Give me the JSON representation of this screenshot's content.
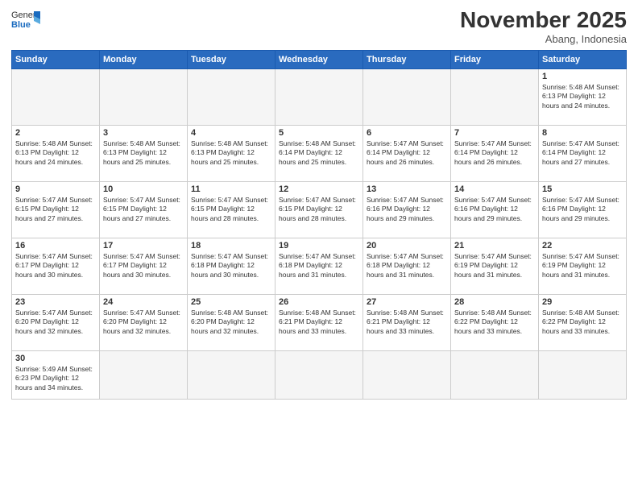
{
  "logo": {
    "line1": "General",
    "line2": "Blue"
  },
  "title": "November 2025",
  "location": "Abang, Indonesia",
  "weekdays": [
    "Sunday",
    "Monday",
    "Tuesday",
    "Wednesday",
    "Thursday",
    "Friday",
    "Saturday"
  ],
  "weeks": [
    [
      {
        "day": "",
        "info": ""
      },
      {
        "day": "",
        "info": ""
      },
      {
        "day": "",
        "info": ""
      },
      {
        "day": "",
        "info": ""
      },
      {
        "day": "",
        "info": ""
      },
      {
        "day": "",
        "info": ""
      },
      {
        "day": "1",
        "info": "Sunrise: 5:48 AM\nSunset: 6:13 PM\nDaylight: 12 hours\nand 24 minutes."
      }
    ],
    [
      {
        "day": "2",
        "info": "Sunrise: 5:48 AM\nSunset: 6:13 PM\nDaylight: 12 hours\nand 24 minutes."
      },
      {
        "day": "3",
        "info": "Sunrise: 5:48 AM\nSunset: 6:13 PM\nDaylight: 12 hours\nand 25 minutes."
      },
      {
        "day": "4",
        "info": "Sunrise: 5:48 AM\nSunset: 6:13 PM\nDaylight: 12 hours\nand 25 minutes."
      },
      {
        "day": "5",
        "info": "Sunrise: 5:48 AM\nSunset: 6:14 PM\nDaylight: 12 hours\nand 25 minutes."
      },
      {
        "day": "6",
        "info": "Sunrise: 5:47 AM\nSunset: 6:14 PM\nDaylight: 12 hours\nand 26 minutes."
      },
      {
        "day": "7",
        "info": "Sunrise: 5:47 AM\nSunset: 6:14 PM\nDaylight: 12 hours\nand 26 minutes."
      },
      {
        "day": "8",
        "info": "Sunrise: 5:47 AM\nSunset: 6:14 PM\nDaylight: 12 hours\nand 27 minutes."
      }
    ],
    [
      {
        "day": "9",
        "info": "Sunrise: 5:47 AM\nSunset: 6:15 PM\nDaylight: 12 hours\nand 27 minutes."
      },
      {
        "day": "10",
        "info": "Sunrise: 5:47 AM\nSunset: 6:15 PM\nDaylight: 12 hours\nand 27 minutes."
      },
      {
        "day": "11",
        "info": "Sunrise: 5:47 AM\nSunset: 6:15 PM\nDaylight: 12 hours\nand 28 minutes."
      },
      {
        "day": "12",
        "info": "Sunrise: 5:47 AM\nSunset: 6:15 PM\nDaylight: 12 hours\nand 28 minutes."
      },
      {
        "day": "13",
        "info": "Sunrise: 5:47 AM\nSunset: 6:16 PM\nDaylight: 12 hours\nand 29 minutes."
      },
      {
        "day": "14",
        "info": "Sunrise: 5:47 AM\nSunset: 6:16 PM\nDaylight: 12 hours\nand 29 minutes."
      },
      {
        "day": "15",
        "info": "Sunrise: 5:47 AM\nSunset: 6:16 PM\nDaylight: 12 hours\nand 29 minutes."
      }
    ],
    [
      {
        "day": "16",
        "info": "Sunrise: 5:47 AM\nSunset: 6:17 PM\nDaylight: 12 hours\nand 30 minutes."
      },
      {
        "day": "17",
        "info": "Sunrise: 5:47 AM\nSunset: 6:17 PM\nDaylight: 12 hours\nand 30 minutes."
      },
      {
        "day": "18",
        "info": "Sunrise: 5:47 AM\nSunset: 6:18 PM\nDaylight: 12 hours\nand 30 minutes."
      },
      {
        "day": "19",
        "info": "Sunrise: 5:47 AM\nSunset: 6:18 PM\nDaylight: 12 hours\nand 31 minutes."
      },
      {
        "day": "20",
        "info": "Sunrise: 5:47 AM\nSunset: 6:18 PM\nDaylight: 12 hours\nand 31 minutes."
      },
      {
        "day": "21",
        "info": "Sunrise: 5:47 AM\nSunset: 6:19 PM\nDaylight: 12 hours\nand 31 minutes."
      },
      {
        "day": "22",
        "info": "Sunrise: 5:47 AM\nSunset: 6:19 PM\nDaylight: 12 hours\nand 31 minutes."
      }
    ],
    [
      {
        "day": "23",
        "info": "Sunrise: 5:47 AM\nSunset: 6:20 PM\nDaylight: 12 hours\nand 32 minutes."
      },
      {
        "day": "24",
        "info": "Sunrise: 5:47 AM\nSunset: 6:20 PM\nDaylight: 12 hours\nand 32 minutes."
      },
      {
        "day": "25",
        "info": "Sunrise: 5:48 AM\nSunset: 6:20 PM\nDaylight: 12 hours\nand 32 minutes."
      },
      {
        "day": "26",
        "info": "Sunrise: 5:48 AM\nSunset: 6:21 PM\nDaylight: 12 hours\nand 33 minutes."
      },
      {
        "day": "27",
        "info": "Sunrise: 5:48 AM\nSunset: 6:21 PM\nDaylight: 12 hours\nand 33 minutes."
      },
      {
        "day": "28",
        "info": "Sunrise: 5:48 AM\nSunset: 6:22 PM\nDaylight: 12 hours\nand 33 minutes."
      },
      {
        "day": "29",
        "info": "Sunrise: 5:48 AM\nSunset: 6:22 PM\nDaylight: 12 hours\nand 33 minutes."
      }
    ],
    [
      {
        "day": "30",
        "info": "Sunrise: 5:49 AM\nSunset: 6:23 PM\nDaylight: 12 hours\nand 34 minutes."
      },
      {
        "day": "",
        "info": ""
      },
      {
        "day": "",
        "info": ""
      },
      {
        "day": "",
        "info": ""
      },
      {
        "day": "",
        "info": ""
      },
      {
        "day": "",
        "info": ""
      },
      {
        "day": "",
        "info": ""
      }
    ]
  ]
}
